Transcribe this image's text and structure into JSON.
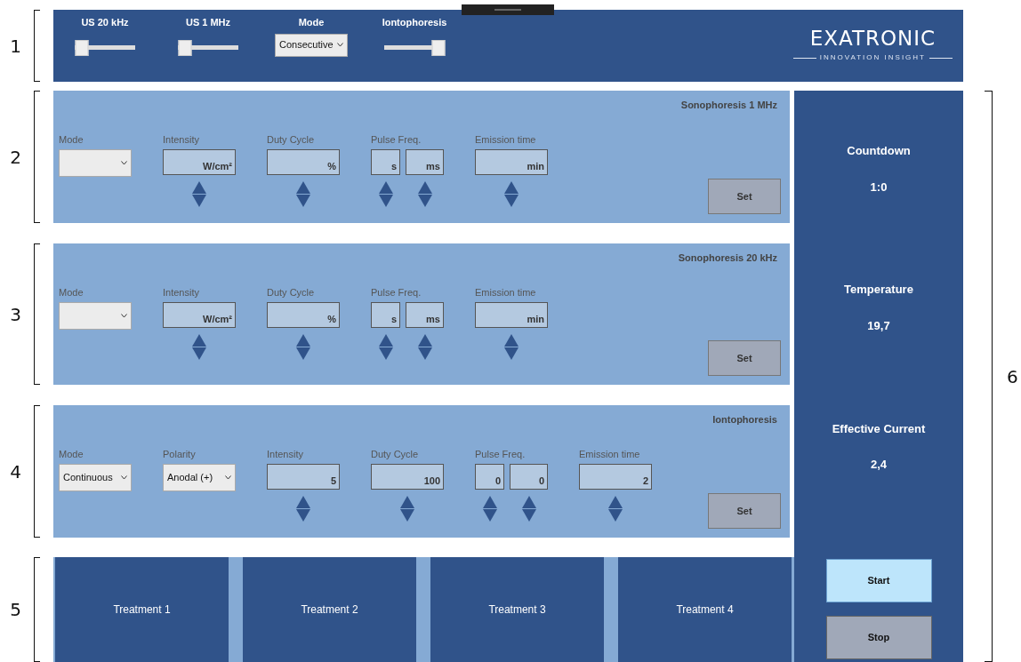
{
  "callouts": [
    {
      "label": "1"
    },
    {
      "label": "2"
    },
    {
      "label": "3"
    },
    {
      "label": "4"
    },
    {
      "label": "5"
    },
    {
      "label": "6"
    }
  ],
  "top_bar": {
    "controls": [
      {
        "kind": "slider",
        "label": "US 20 kHz",
        "level": 0
      },
      {
        "kind": "slider",
        "label": "US 1 MHz",
        "level": 0
      },
      {
        "kind": "select",
        "label": "Mode",
        "value": "Consecutive"
      },
      {
        "kind": "slider",
        "label": "Iontophoresis",
        "level": 1
      }
    ],
    "logo": {
      "name": "EXATRONIC",
      "tagline": "INNOVATION INSIGHT"
    }
  },
  "panels": [
    {
      "title": "Sonophoresis 1 MHz",
      "button": "Set",
      "fields": [
        {
          "kind": "select",
          "label": "Mode"
        },
        {
          "kind": "spin",
          "label": "Intensity",
          "inputs": [
            {
              "text": "W/cm²"
            }
          ]
        },
        {
          "kind": "spin",
          "label": "Duty Cycle",
          "inputs": [
            {
              "text": "%"
            }
          ]
        },
        {
          "kind": "spin",
          "label": "Pulse Freq.",
          "inputs": [
            {
              "text": "s"
            },
            {
              "text": "ms"
            }
          ]
        },
        {
          "kind": "spin",
          "label": "Emission time",
          "inputs": [
            {
              "text": "min"
            }
          ]
        }
      ]
    },
    {
      "title": "Sonophoresis 20 kHz",
      "button": "Set",
      "fields": [
        {
          "kind": "select",
          "label": "Mode"
        },
        {
          "kind": "spin",
          "label": "Intensity",
          "inputs": [
            {
              "text": "W/cm²"
            }
          ]
        },
        {
          "kind": "spin",
          "label": "Duty Cycle",
          "inputs": [
            {
              "text": "%"
            }
          ]
        },
        {
          "kind": "spin",
          "label": "Pulse Freq.",
          "inputs": [
            {
              "text": "s"
            },
            {
              "text": "ms"
            }
          ]
        },
        {
          "kind": "spin",
          "label": "Emission time",
          "inputs": [
            {
              "text": "min"
            }
          ]
        }
      ]
    },
    {
      "title": "Iontophoresis",
      "button": "Set",
      "fields": [
        {
          "kind": "select",
          "label": "Mode",
          "value": "Continuous"
        },
        {
          "kind": "select",
          "label": "Polarity",
          "value": "Anodal (+)"
        },
        {
          "kind": "spin",
          "label": "Intensity",
          "inputs": [
            {
              "text": "5"
            }
          ]
        },
        {
          "kind": "spin",
          "label": "Duty Cycle",
          "inputs": [
            {
              "text": "100"
            }
          ]
        },
        {
          "kind": "spin",
          "label": "Pulse Freq.",
          "inputs": [
            {
              "text": "0"
            },
            {
              "text": "0"
            }
          ]
        },
        {
          "kind": "spin",
          "label": "Emission time",
          "inputs": [
            {
              "text": "2"
            }
          ]
        }
      ]
    }
  ],
  "treatments": [
    "Treatment 1",
    "Treatment 2",
    "Treatment 3",
    "Treatment 4"
  ],
  "status": {
    "readings": [
      {
        "label": "Countdown",
        "value": "1:0"
      },
      {
        "label": "Temperature",
        "value": "19,7"
      },
      {
        "label": "Effective Current",
        "value": "2,4"
      }
    ],
    "buttons": [
      {
        "label": "Start",
        "kind": "primary"
      },
      {
        "label": "Stop",
        "kind": "secondary"
      }
    ]
  }
}
